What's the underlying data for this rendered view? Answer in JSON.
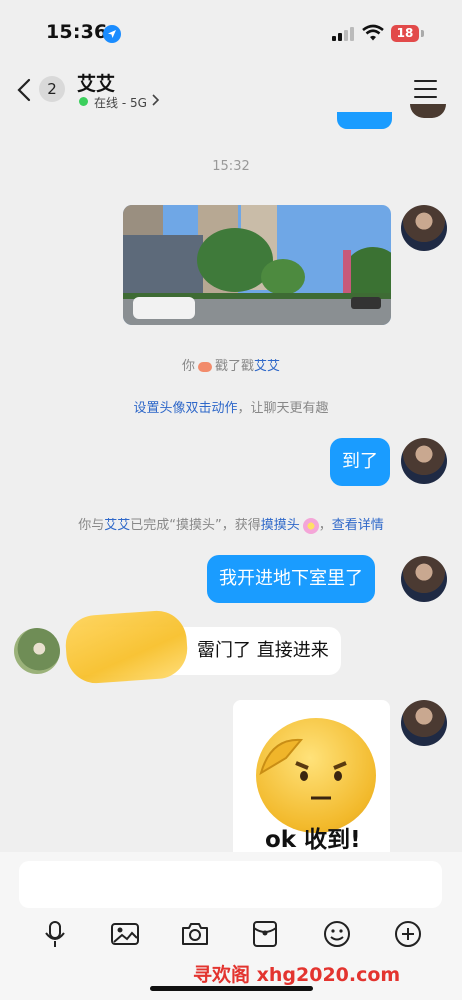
{
  "status_bar": {
    "time": "15:36",
    "battery": "18"
  },
  "header": {
    "unread_count": "2",
    "title": "艾艾",
    "status": "在线 - 5G"
  },
  "messages": {
    "timestamp": "15:32",
    "poke_you": "你",
    "poke_action": "戳了戳",
    "poke_name": "艾艾",
    "set_avatar_link": "设置头像双击动作",
    "set_avatar_rest": "，让聊天更有趣",
    "msg_arrived": "到了",
    "achv_prefix": "你与",
    "achv_name": "艾艾",
    "achv_mid": "已完成“摸摸头”，获得",
    "achv_badge": "摸摸头",
    "achv_sep": "，",
    "achv_detail": "查看详情",
    "msg_basement": "我开进地下室里了",
    "msg_friend_visible": "霤门了 直接进来",
    "sticker_text": "ok 收到!"
  },
  "toolbar": {
    "icons": [
      "microphone-icon",
      "image-icon",
      "camera-icon",
      "red-packet-icon",
      "emoji-icon",
      "plus-icon"
    ]
  },
  "watermark": "寻欢阁 xhg2020.com",
  "colors": {
    "accent": "#1a9cff",
    "link": "#2f68c9",
    "online": "#3bcf5c",
    "battery": "#e24a4a"
  }
}
